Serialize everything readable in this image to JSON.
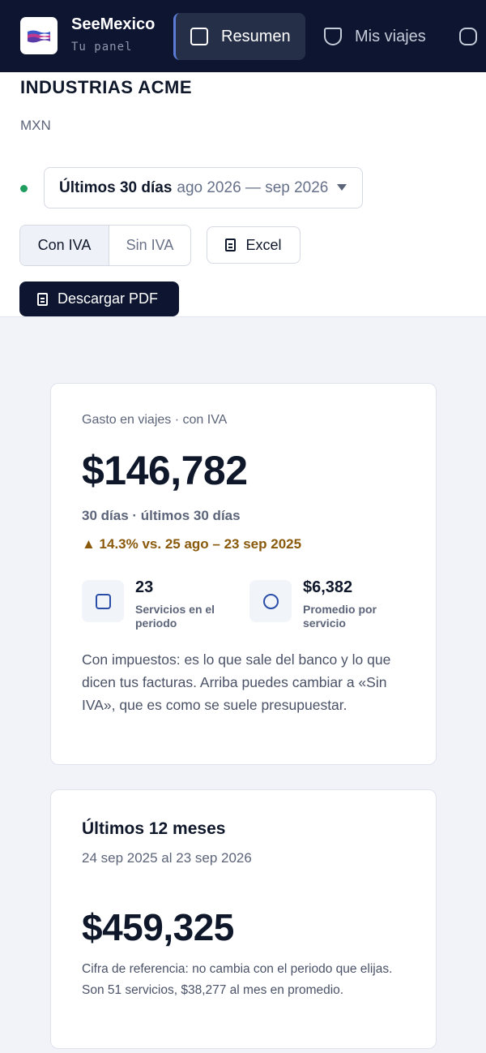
{
  "nav": {
    "brand": "SeeMexico",
    "subtitle": "Tu panel",
    "tabs": [
      {
        "label": "Resumen",
        "icon": "square-icon",
        "active": true
      },
      {
        "label": "Mis viajes",
        "icon": "shield-icon",
        "active": false
      },
      {
        "label": "",
        "icon": "rounded-icon",
        "active": false
      }
    ]
  },
  "header": {
    "company": "INDUSTRIAS ACME",
    "currency": "MXN",
    "range_label": "Últimos 30 días",
    "range_dates": "ago 2026 — sep 2026",
    "tax_toggle": {
      "on": "Con IVA",
      "off": "Sin IVA"
    },
    "excel_label": "Excel",
    "pdf_label": "Descargar PDF",
    "status_color": "#1f9d5e"
  },
  "summary": {
    "label": "Gasto en viajes · con IVA",
    "amount": "$146,782",
    "period": "30 días · últimos 30 días",
    "delta": "▲ 14.3% vs. 25 ago – 23 sep 2025",
    "stats": [
      {
        "value": "23",
        "caption": "Servicios en el periodo",
        "icon": "square-icon"
      },
      {
        "value": "$6,382",
        "caption": "Promedio por servicio",
        "icon": "circle-icon"
      }
    ],
    "note": "Con impuestos: es lo que sale del banco y lo que dicen tus facturas. Arriba puedes cambiar a «Sin IVA», que es como se suele presupuestar."
  },
  "yearly": {
    "title": "Últimos 12 meses",
    "range": "24 sep 2025 al 23 sep 2026",
    "amount": "$459,325",
    "note": "Cifra de referencia: no cambia con el periodo que elijas. Son 51 servicios, $38,277 al mes en promedio."
  },
  "colors": {
    "nav_bg": "#0d1530",
    "accent": "#5b7bd6",
    "delta": "#8a5a0c"
  }
}
